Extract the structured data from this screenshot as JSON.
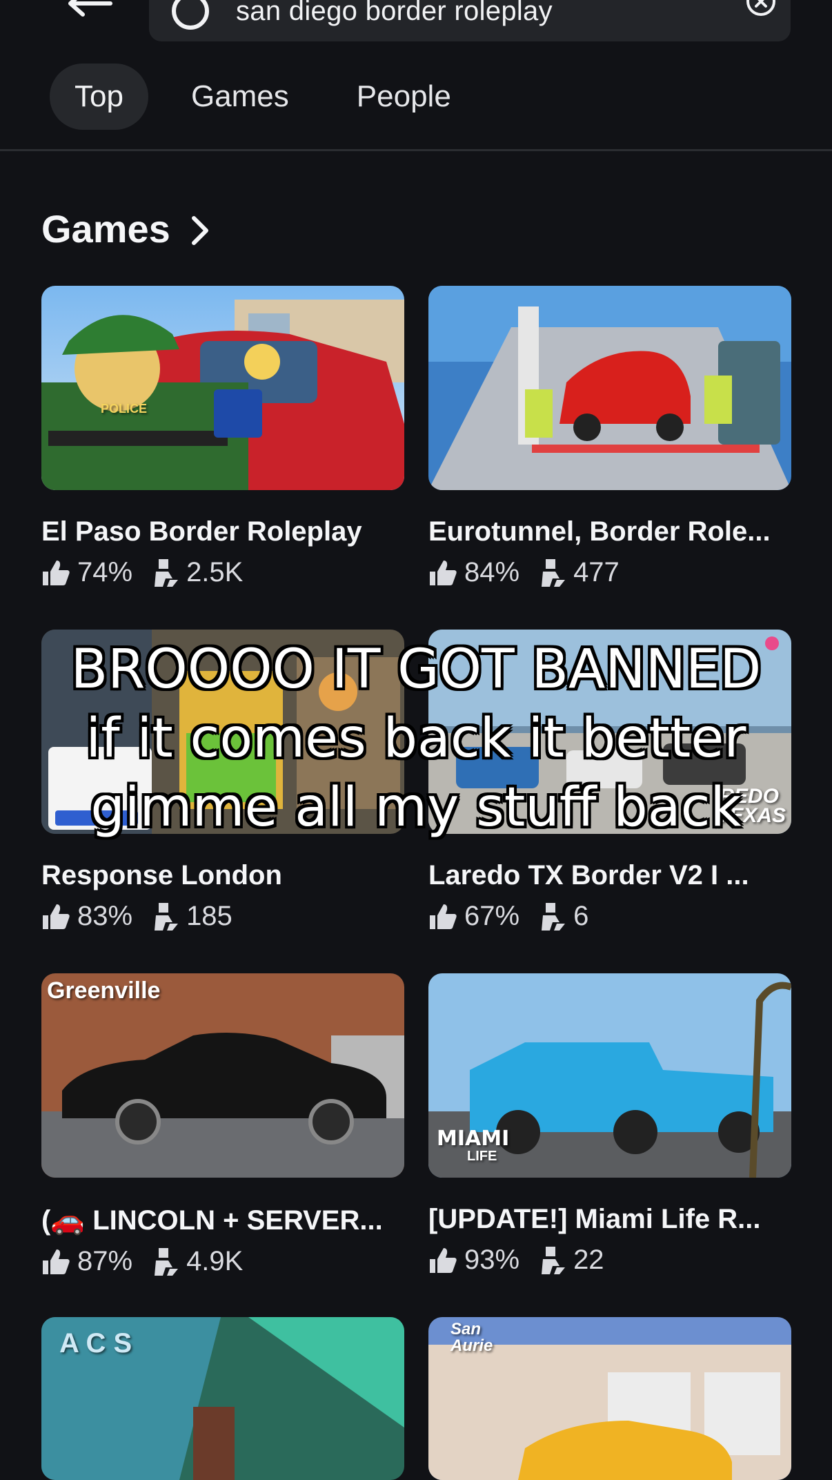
{
  "search": {
    "query": "san diego border roleplay"
  },
  "tabs": [
    {
      "label": "Top",
      "active": true
    },
    {
      "label": "Games",
      "active": false
    },
    {
      "label": "People",
      "active": false
    }
  ],
  "section": {
    "title": "Games"
  },
  "games": [
    {
      "title": "El Paso Border Roleplay",
      "rating": "74%",
      "players": "2.5K"
    },
    {
      "title": "Eurotunnel, Border Role...",
      "rating": "84%",
      "players": "477"
    },
    {
      "title": "Response London",
      "rating": "83%",
      "players": "185"
    },
    {
      "title": "Laredo TX Border V2 I ...",
      "rating": "67%",
      "players": "6"
    },
    {
      "title": "(🚗 LINCOLN + SERVER...",
      "rating": "87%",
      "players": "4.9K"
    },
    {
      "title": "[UPDATE!] Miami Life R...",
      "rating": "93%",
      "players": "22"
    }
  ],
  "thumb_labels": {
    "greenville": "Greenville",
    "miami": "MIAMI",
    "miami_life": "LIFE",
    "acs": "A C S",
    "san_aurie": "San Aurie",
    "police": "POLICE",
    "redo_texas": "REDO TEXAS"
  },
  "overlay_caption": {
    "line1": "BROOOO IT GOT BANNED",
    "line2": "if it comes back it better",
    "line3": "gimme all my stuff back"
  },
  "colors": {
    "background": "#111216",
    "surface": "#232529",
    "text": "#f2f3f5"
  }
}
